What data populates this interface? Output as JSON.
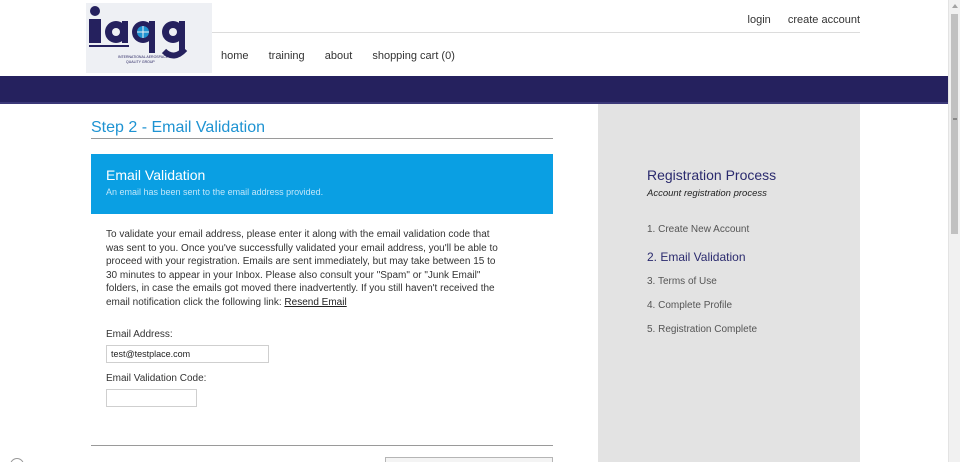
{
  "header": {
    "login_label": "login",
    "create_account_label": "create account",
    "nav": [
      "home",
      "training",
      "about",
      "shopping cart (0)"
    ],
    "logo": {
      "text": "iaqg",
      "tagline_line1": "INTERNATIONAL AEROSPACE",
      "tagline_line2": "QUALITY GROUP"
    }
  },
  "main": {
    "title": "Step 2 - Email Validation",
    "info_heading": "Email Validation",
    "info_sub": "An email has been sent to the email address provided.",
    "instructions": "To validate your email address, please enter it along with the email validation code that was sent to you. Once you've successfully validated your email address, you'll be able to proceed with your registration. Emails are sent immediately, but may take between 15 to 30 minutes to appear in your Inbox. Please also consult your \"Spam\" or \"Junk Email\" folders, in case the emails got moved there inadvertently. If you still haven't received the email notification click the following link: ",
    "resend_link": "Resend Email",
    "email_label": "Email Address:",
    "email_value": "test@testplace.com",
    "code_label": "Email Validation Code:",
    "code_value": ""
  },
  "sidebar": {
    "title": "Registration Process",
    "subtitle": "Account registration process",
    "steps": [
      "1. Create New Account",
      "2. Email Validation",
      "3. Terms of Use",
      "4. Complete Profile",
      "5. Registration Complete"
    ],
    "active_step": 2
  },
  "colors": {
    "navy": "#25215e",
    "accent_blue": "#0a9fe3",
    "title_blue": "#1e93d2",
    "sidebar_bg": "#e3e3e3"
  }
}
